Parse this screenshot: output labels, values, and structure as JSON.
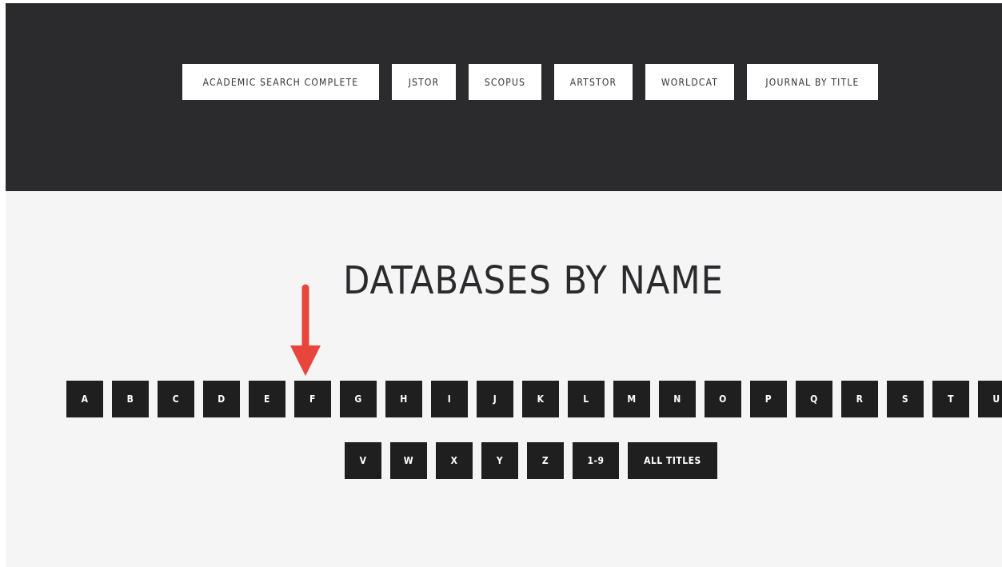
{
  "database_links": [
    {
      "label": "ACADEMIC SEARCH COMPLETE"
    },
    {
      "label": "JSTOR"
    },
    {
      "label": "SCOPUS"
    },
    {
      "label": "ARTSTOR"
    },
    {
      "label": "WORLDCAT"
    },
    {
      "label": "JOURNAL BY TITLE"
    }
  ],
  "section": {
    "title": "DATABASES BY NAME"
  },
  "alphabet_row1": [
    "A",
    "B",
    "C",
    "D",
    "E",
    "F",
    "G",
    "H",
    "I",
    "J",
    "K",
    "L",
    "M",
    "N",
    "O",
    "P",
    "Q",
    "R",
    "S",
    "T",
    "U"
  ],
  "alphabet_row2": [
    "V",
    "W",
    "X",
    "Y",
    "Z",
    "1-9",
    "ALL TITLES"
  ],
  "annotation": {
    "arrow_color": "#e8453c",
    "points_to": "F"
  },
  "colors": {
    "header_bg": "#2b2a2d",
    "content_bg": "#f5f5f5",
    "letter_button_bg": "#1f1f1f"
  }
}
